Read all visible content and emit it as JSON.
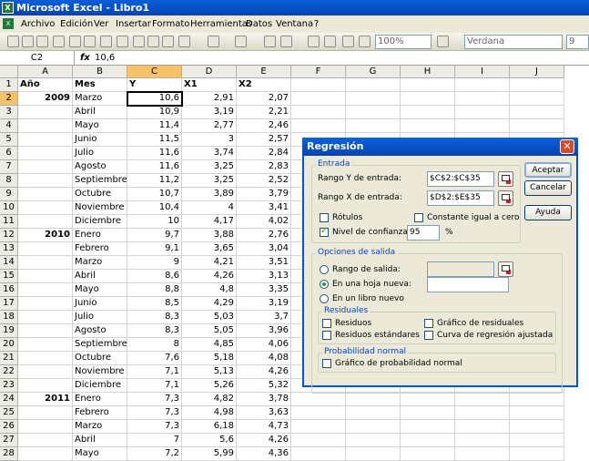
{
  "window": {
    "title": "Microsoft Excel - Libro1",
    "app_icon": "X"
  },
  "menu": [
    "Archivo",
    "Edición",
    "Ver",
    "Insertar",
    "Formato",
    "Herramientas",
    "Datos",
    "Ventana",
    "?"
  ],
  "toolbar": {
    "zoom": "100%",
    "font": "Verdana",
    "font_size": "9"
  },
  "formula_bar": {
    "name_box": "C2",
    "fx": "fx",
    "value": "10,6"
  },
  "columns": [
    "A",
    "B",
    "C",
    "D",
    "E",
    "F",
    "G",
    "H",
    "I",
    "J"
  ],
  "selected_column": "C",
  "selected_row": 2,
  "headers": {
    "a": "Año",
    "b": "Mes",
    "c": "Y",
    "d": "X1",
    "e": "X2"
  },
  "rows": [
    {
      "n": "2",
      "a": "2009",
      "b": "Marzo",
      "c": "10,6",
      "d": "2,91",
      "e": "2,07"
    },
    {
      "n": "3",
      "a": "",
      "b": "Abril",
      "c": "10,9",
      "d": "3,19",
      "e": "2,21"
    },
    {
      "n": "4",
      "a": "",
      "b": "Mayo",
      "c": "11,4",
      "d": "2,77",
      "e": "2,46"
    },
    {
      "n": "5",
      "a": "",
      "b": "Junio",
      "c": "11,5",
      "d": "3",
      "e": "2,57"
    },
    {
      "n": "6",
      "a": "",
      "b": "Julio",
      "c": "11,6",
      "d": "3,74",
      "e": "2,84"
    },
    {
      "n": "7",
      "a": "",
      "b": "Agosto",
      "c": "11,6",
      "d": "3,25",
      "e": "2,83"
    },
    {
      "n": "8",
      "a": "",
      "b": "Septiembre",
      "c": "11,2",
      "d": "3,25",
      "e": "2,52"
    },
    {
      "n": "9",
      "a": "",
      "b": "Octubre",
      "c": "10,7",
      "d": "3,89",
      "e": "3,79"
    },
    {
      "n": "10",
      "a": "",
      "b": "Noviembre",
      "c": "10,4",
      "d": "4",
      "e": "3,41"
    },
    {
      "n": "11",
      "a": "",
      "b": "Diciembre",
      "c": "10",
      "d": "4,17",
      "e": "4,02"
    },
    {
      "n": "12",
      "a": "2010",
      "b": "Enero",
      "c": "9,7",
      "d": "3,88",
      "e": "2,76"
    },
    {
      "n": "13",
      "a": "",
      "b": "Febrero",
      "c": "9,1",
      "d": "3,65",
      "e": "3,04"
    },
    {
      "n": "14",
      "a": "",
      "b": "Marzo",
      "c": "9",
      "d": "4,21",
      "e": "3,51"
    },
    {
      "n": "15",
      "a": "",
      "b": "Abril",
      "c": "8,6",
      "d": "4,26",
      "e": "3,13"
    },
    {
      "n": "16",
      "a": "",
      "b": "Mayo",
      "c": "8,8",
      "d": "4,8",
      "e": "3,35"
    },
    {
      "n": "17",
      "a": "",
      "b": "Junio",
      "c": "8,5",
      "d": "4,29",
      "e": "3,19"
    },
    {
      "n": "18",
      "a": "",
      "b": "Julio",
      "c": "8,3",
      "d": "5,03",
      "e": "3,7"
    },
    {
      "n": "19",
      "a": "",
      "b": "Agosto",
      "c": "8,3",
      "d": "5,05",
      "e": "3,96"
    },
    {
      "n": "20",
      "a": "",
      "b": "Septiembre",
      "c": "8",
      "d": "4,85",
      "e": "4,06"
    },
    {
      "n": "21",
      "a": "",
      "b": "Octubre",
      "c": "7,6",
      "d": "5,18",
      "e": "4,08"
    },
    {
      "n": "22",
      "a": "",
      "b": "Noviembre",
      "c": "7,1",
      "d": "5,13",
      "e": "4,26"
    },
    {
      "n": "23",
      "a": "",
      "b": "Diciembre",
      "c": "7,1",
      "d": "5,26",
      "e": "5,32"
    },
    {
      "n": "24",
      "a": "2011",
      "b": "Enero",
      "c": "7,3",
      "d": "4,82",
      "e": "3,78"
    },
    {
      "n": "25",
      "a": "",
      "b": "Febrero",
      "c": "7,3",
      "d": "4,98",
      "e": "3,63"
    },
    {
      "n": "26",
      "a": "",
      "b": "Marzo",
      "c": "7,3",
      "d": "6,18",
      "e": "4,73"
    },
    {
      "n": "27",
      "a": "",
      "b": "Abril",
      "c": "7",
      "d": "5,6",
      "e": "4,26"
    },
    {
      "n": "28",
      "a": "",
      "b": "Mayo",
      "c": "7,2",
      "d": "5,99",
      "e": "4,36"
    }
  ],
  "dialog": {
    "title": "Regresión",
    "entrada": {
      "label": "Entrada",
      "rango_y_label": "Rango Y de entrada:",
      "rango_y_value": "$C$2:$C$35",
      "rango_x_label": "Rango X de entrada:",
      "rango_x_value": "$D$2:$E$35",
      "rotulos": "Rótulos",
      "rotulos_checked": false,
      "constante": "Constante igual a cero",
      "constante_checked": false,
      "nivel": "Nivel de confianza",
      "nivel_checked": true,
      "nivel_value": "95",
      "percent": "%"
    },
    "salida": {
      "label": "Opciones de salida",
      "rango_salida": "Rango de salida:",
      "hoja_nueva": "En una hoja nueva:",
      "libro_nuevo": "En un libro nuevo",
      "selected": "hoja_nueva"
    },
    "residuales": {
      "label": "Residuales",
      "residuos": "Residuos",
      "residuos_std": "Residuos estándares",
      "grafico_res": "Gráfico de residuales",
      "curva": "Curva de regresión ajustada"
    },
    "probabilidad": {
      "label": "Probabilidad normal",
      "grafico": "Gráfico de probabilidad normal"
    },
    "buttons": {
      "ok": "Aceptar",
      "cancel": "Cancelar",
      "help": "Ayuda"
    },
    "close": "✕"
  }
}
